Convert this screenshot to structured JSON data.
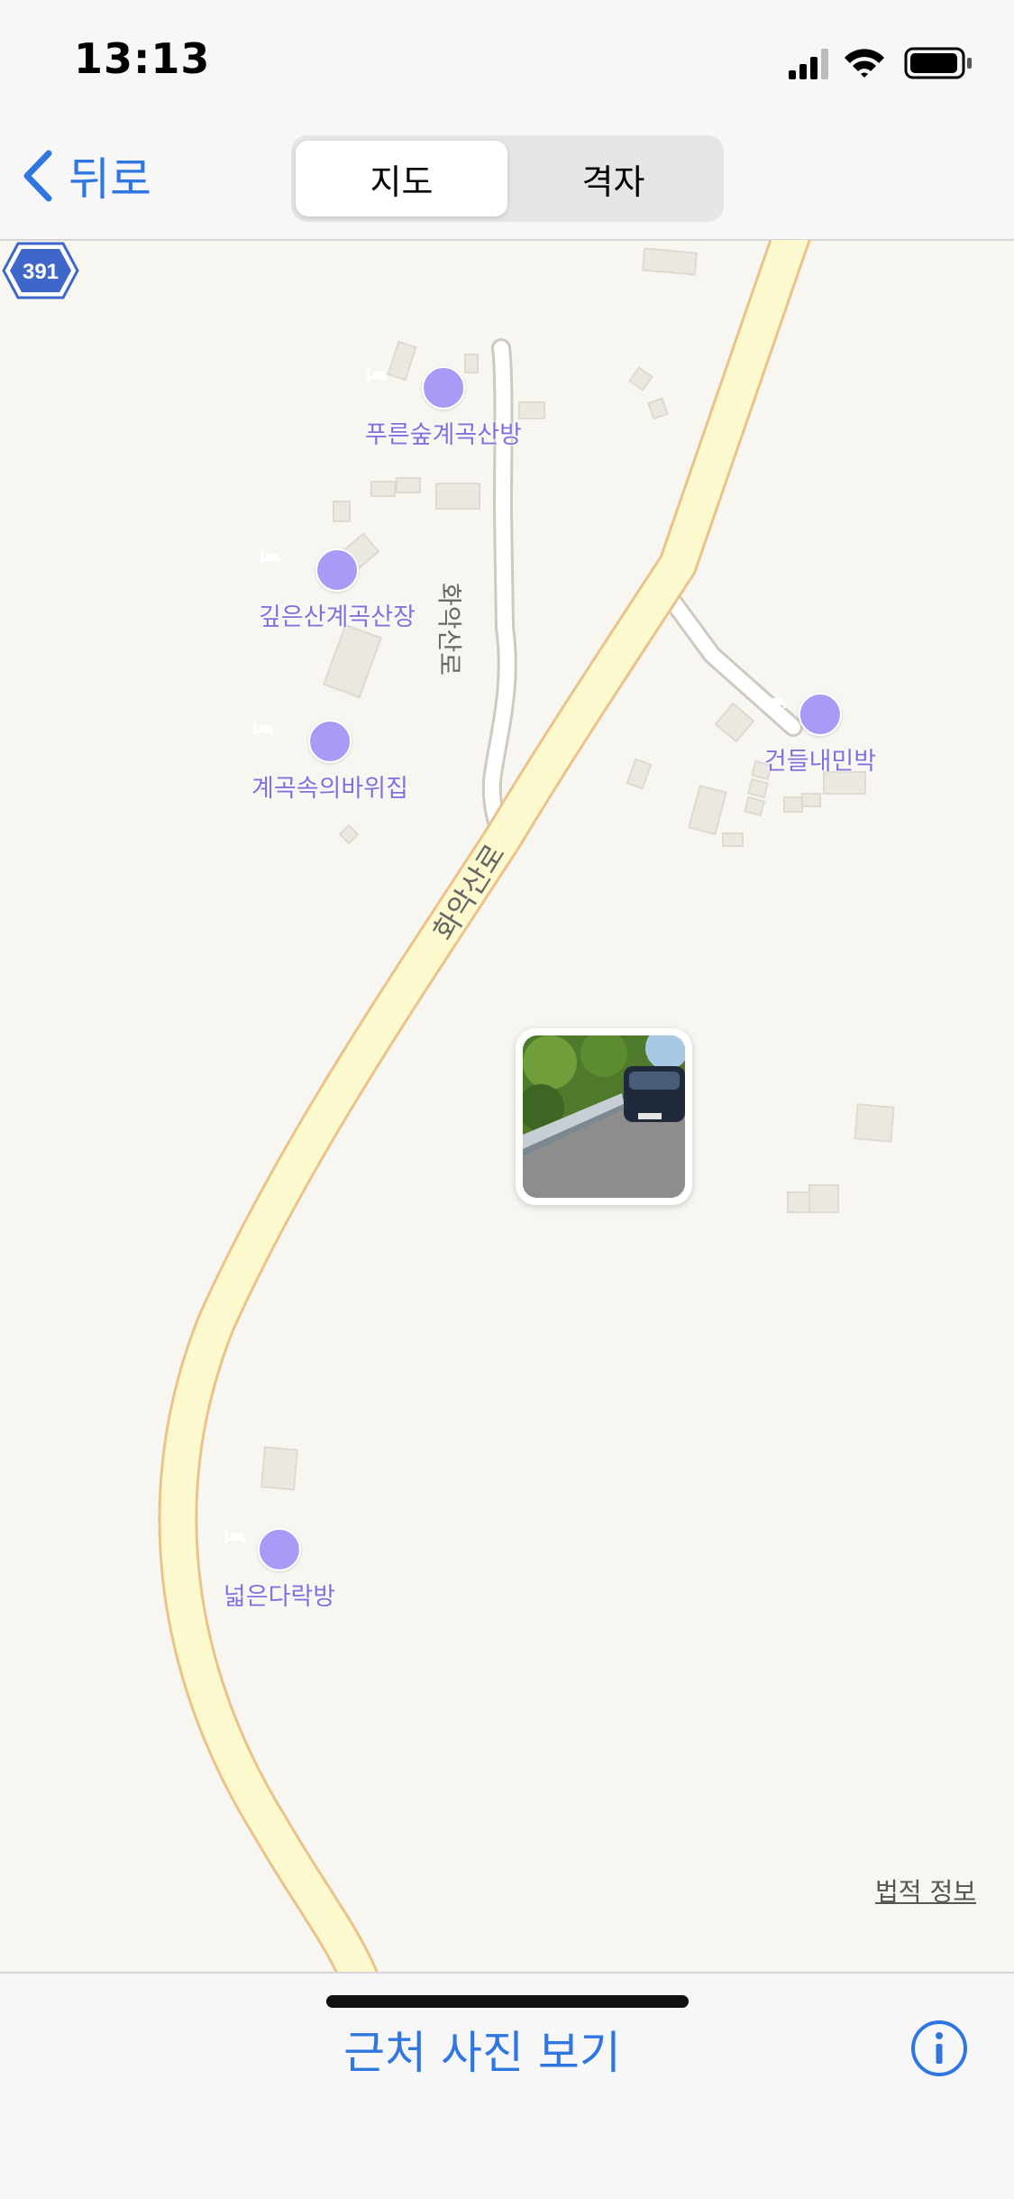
{
  "status_bar": {
    "time": "13:13"
  },
  "nav": {
    "back_label": "뒤로",
    "segments": [
      "지도",
      "격자"
    ],
    "selected_segment": "지도"
  },
  "map": {
    "route_shield": "391",
    "road_labels": [
      "화악산로",
      "화악산로"
    ],
    "pois": [
      "푸른숲계곡산방",
      "깊은산계곡산장",
      "계곡속의바위집",
      "건들내민박",
      "넓은다락방"
    ],
    "legal_link": "법적 정보",
    "photo_thumbnail_icon": "car-photo-thumbnail"
  },
  "bottom": {
    "nearby_photos": "근처 사진 보기",
    "info_icon": "info-icon"
  },
  "colors": {
    "accent": "#2f76e0",
    "poi": "#a79bf5",
    "poi_text": "#8470dc",
    "road_fill": "#fdf9cf",
    "road_border": "#eac38a"
  }
}
